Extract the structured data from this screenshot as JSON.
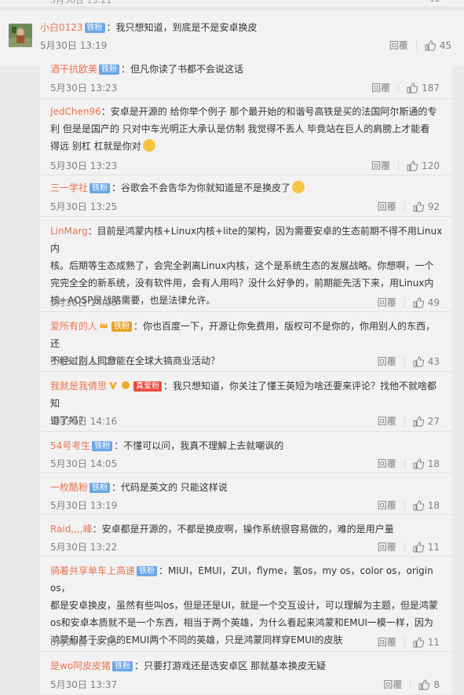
{
  "top": {
    "timestamp": "5月30日 13:21",
    "like_count": "12"
  },
  "main_comment": {
    "user": "小白0123",
    "badge": "铁粉",
    "text": "：我只想知道，到底是不是安卓换皮",
    "time": "5月30日 13:19",
    "reply_label": "回覆",
    "likes": "45"
  },
  "replies": [
    {
      "user": "酒干抗欧美",
      "badge": "铁粉",
      "lines": [
        "：但凡你读了书都不会说这话"
      ],
      "time": "5月30日 13:23",
      "reply_label": "回覆",
      "likes": "187"
    },
    {
      "user": "JedChen96",
      "badge": "",
      "lines": [
        "：安卓是开源的 给你举个例子 那个最开始的和谐号高铁是买的法国阿尔斯通的专",
        "利 但是是国产的 只对中车光明正大承认是仿制 我觉得不丢人 毕竟站在巨人的肩膀上才能看",
        "得远 别杠 杠就是你对"
      ],
      "time": "5月30日 13:23",
      "reply_label": "回覆",
      "likes": "120"
    },
    {
      "user": "三一学社",
      "badge": "铁粉",
      "lines": [
        "：谷歌会不会告华为你就知道是不是换皮了"
      ],
      "time": "5月30日 13:25",
      "reply_label": "回覆",
      "likes": "92"
    },
    {
      "user": "LinMarg",
      "badge": "",
      "lines": [
        "：目前是鸿蒙内核+Linux内核+lite的架构，因为需要安卓的生态前期不得不用Linux内",
        "核。后期等生态成熟了，会完全剥离Linux内核，这个是系统生态的发展战略。你想啊，一个",
        "完完全全的新系统，没有软件用，会有人用吗？没什么好争的，前期能先活下来，用Linux内",
        "核+AOSP是战略需要，也是法律允许。"
      ],
      "time": "5月30日 14:00",
      "reply_label": "回覆",
      "likes": "49"
    },
    {
      "user": "爱所有的人",
      "badge": "铁粉",
      "lines": [
        "：你也百度一下，开源让你免费用，版权可不是你的，你用别人的东西，还",
        "不经过别人同意能在全球大搞商业活动？"
      ],
      "time": "5月30日 13:27",
      "reply_label": "回覆",
      "likes": "43"
    },
    {
      "user": "我就是我倩思",
      "badge": "真爱粉",
      "lines": [
        "：我只想知道，你关注了懂王英短为啥还要来评论？找他不就啥都知",
        "道了吗？"
      ],
      "time": "5月30日 14:16",
      "reply_label": "回覆",
      "likes": "27"
    },
    {
      "user": "54号考生",
      "badge": "铁粉",
      "lines": [
        "：不懂可以问，我真不理解上去就嘲讽的"
      ],
      "time": "5月30日 14:05",
      "reply_label": "回覆",
      "likes": "18"
    },
    {
      "user": "一枚酷粉",
      "badge": "铁粉",
      "lines": [
        "：代码是英文的 只能这样说"
      ],
      "time": "5月30日 13:19",
      "reply_label": "回覆",
      "likes": "18"
    },
    {
      "user": "Raid,,,,峰",
      "badge": "",
      "lines": [
        "：安卓都是开源的，不都是换皮啊，操作系统很容易做的，难的是用户量"
      ],
      "time": "5月30日 13:22",
      "reply_label": "回覆",
      "likes": "11"
    },
    {
      "user": "骑着共享单车上高速",
      "badge": "铁粉",
      "lines": [
        "：MIUI，EMUI，ZUI，flyme，氢os，my os，color os，origin os，",
        "都是安卓换皮，虽然有些叫os，但是还是UI，就是一个交互设计，可以理解为主题，但是鸿蒙",
        "os和安卓本质就不是一个东西，相当于两个英雄，为什么看起来鸿蒙和EMUI一模一样，因为",
        "鸿蒙和基于安卓的EMUI两个不同的英雄，只是鸿蒙同样穿EMUI的皮肤"
      ],
      "time": "5月30日 14:15",
      "reply_label": "回覆",
      "likes": "11"
    },
    {
      "user": "是wo阿皮皮猪",
      "badge": "铁粉",
      "lines": [
        "：只要打游戏还是选安卓区 那就基本换皮无疑"
      ],
      "time": "5月30日 13:37",
      "reply_label": "回覆",
      "likes": "8"
    }
  ],
  "colors": {
    "username": "#eb7350",
    "badge": "#6aa7e6",
    "meta": "#808080",
    "background": "#f2f2f2"
  }
}
